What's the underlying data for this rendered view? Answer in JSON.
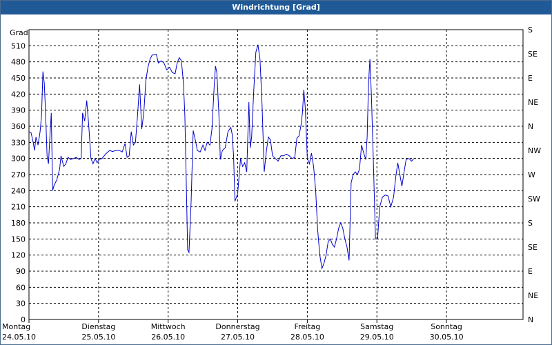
{
  "window": {
    "title": "Windrichtung [Grad]"
  },
  "chart_data": {
    "type": "line",
    "title": "Windrichtung [Grad]",
    "ylabel": "Grad",
    "ylim": [
      0,
      540
    ],
    "y_ticks": [
      0,
      30,
      60,
      90,
      120,
      150,
      180,
      210,
      240,
      270,
      300,
      330,
      360,
      390,
      420,
      450,
      480,
      510
    ],
    "y2_ticks": [
      "N",
      "NE",
      "E",
      "SE",
      "S",
      "SW",
      "W",
      "NW",
      "N",
      "NE",
      "E",
      "SE",
      "S"
    ],
    "x_days": [
      {
        "day": "Montag",
        "date": "24.05.10"
      },
      {
        "day": "Dienstag",
        "date": "25.05.10"
      },
      {
        "day": "Mittwoch",
        "date": "26.05.10"
      },
      {
        "day": "Donnerstag",
        "date": "27.05.10"
      },
      {
        "day": "Freitag",
        "date": "28.05.10"
      },
      {
        "day": "Samstag",
        "date": "29.05.10"
      },
      {
        "day": "Sonntag",
        "date": "30.05.10"
      }
    ],
    "xlim_days": [
      0,
      7.1
    ],
    "grid": true,
    "series": [
      {
        "color": "#0000cc",
        "points": [
          [
            0.0,
            350
          ],
          [
            0.03,
            348
          ],
          [
            0.06,
            330
          ],
          [
            0.08,
            315
          ],
          [
            0.1,
            340
          ],
          [
            0.13,
            325
          ],
          [
            0.16,
            350
          ],
          [
            0.18,
            380
          ],
          [
            0.2,
            462
          ],
          [
            0.22,
            440
          ],
          [
            0.24,
            380
          ],
          [
            0.26,
            305
          ],
          [
            0.28,
            290
          ],
          [
            0.3,
            340
          ],
          [
            0.32,
            385
          ],
          [
            0.34,
            240
          ],
          [
            0.36,
            250
          ],
          [
            0.4,
            260
          ],
          [
            0.44,
            280
          ],
          [
            0.46,
            305
          ],
          [
            0.48,
            295
          ],
          [
            0.5,
            285
          ],
          [
            0.53,
            290
          ],
          [
            0.56,
            302
          ],
          [
            0.6,
            298
          ],
          [
            0.64,
            300
          ],
          [
            0.68,
            302
          ],
          [
            0.72,
            298
          ],
          [
            0.75,
            300
          ],
          [
            0.77,
            385
          ],
          [
            0.8,
            370
          ],
          [
            0.83,
            408
          ],
          [
            0.86,
            360
          ],
          [
            0.89,
            300
          ],
          [
            0.92,
            290
          ],
          [
            0.95,
            300
          ],
          [
            0.98,
            292
          ],
          [
            1.01,
            298
          ],
          [
            1.05,
            300
          ],
          [
            1.1,
            308
          ],
          [
            1.16,
            315
          ],
          [
            1.2,
            313
          ],
          [
            1.25,
            315
          ],
          [
            1.3,
            315
          ],
          [
            1.34,
            312
          ],
          [
            1.38,
            328
          ],
          [
            1.41,
            302
          ],
          [
            1.44,
            305
          ],
          [
            1.47,
            350
          ],
          [
            1.5,
            325
          ],
          [
            1.53,
            330
          ],
          [
            1.56,
            380
          ],
          [
            1.59,
            438
          ],
          [
            1.62,
            355
          ],
          [
            1.65,
            385
          ],
          [
            1.68,
            445
          ],
          [
            1.71,
            470
          ],
          [
            1.74,
            485
          ],
          [
            1.77,
            493
          ],
          [
            1.8,
            493
          ],
          [
            1.83,
            494
          ],
          [
            1.86,
            478
          ],
          [
            1.9,
            482
          ],
          [
            1.94,
            478
          ],
          [
            1.98,
            465
          ],
          [
            2.02,
            470
          ],
          [
            2.06,
            460
          ],
          [
            2.1,
            458
          ],
          [
            2.13,
            478
          ],
          [
            2.16,
            488
          ],
          [
            2.19,
            482
          ],
          [
            2.22,
            440
          ],
          [
            2.24,
            380
          ],
          [
            2.26,
            260
          ],
          [
            2.28,
            130
          ],
          [
            2.3,
            125
          ],
          [
            2.33,
            220
          ],
          [
            2.36,
            352
          ],
          [
            2.39,
            335
          ],
          [
            2.42,
            315
          ],
          [
            2.46,
            312
          ],
          [
            2.5,
            325
          ],
          [
            2.53,
            315
          ],
          [
            2.56,
            330
          ],
          [
            2.6,
            325
          ],
          [
            2.63,
            355
          ],
          [
            2.66,
            430
          ],
          [
            2.68,
            472
          ],
          [
            2.7,
            460
          ],
          [
            2.73,
            380
          ],
          [
            2.75,
            298
          ],
          [
            2.78,
            315
          ],
          [
            2.82,
            320
          ],
          [
            2.86,
            350
          ],
          [
            2.9,
            358
          ],
          [
            2.92,
            345
          ],
          [
            2.94,
            305
          ],
          [
            2.96,
            220
          ],
          [
            3.0,
            235
          ],
          [
            3.04,
            300
          ],
          [
            3.07,
            285
          ],
          [
            3.1,
            292
          ],
          [
            3.13,
            275
          ],
          [
            3.16,
            405
          ],
          [
            3.18,
            320
          ],
          [
            3.2,
            340
          ],
          [
            3.23,
            425
          ],
          [
            3.26,
            498
          ],
          [
            3.29,
            512
          ],
          [
            3.32,
            485
          ],
          [
            3.35,
            400
          ],
          [
            3.38,
            275
          ],
          [
            3.41,
            312
          ],
          [
            3.44,
            340
          ],
          [
            3.47,
            335
          ],
          [
            3.5,
            305
          ],
          [
            3.54,
            300
          ],
          [
            3.58,
            295
          ],
          [
            3.62,
            305
          ],
          [
            3.66,
            305
          ],
          [
            3.7,
            308
          ],
          [
            3.74,
            305
          ],
          [
            3.78,
            300
          ],
          [
            3.82,
            302
          ],
          [
            3.85,
            338
          ],
          [
            3.88,
            342
          ],
          [
            3.91,
            362
          ],
          [
            3.93,
            385
          ],
          [
            3.95,
            428
          ],
          [
            3.97,
            395
          ],
          [
            4.0,
            300
          ],
          [
            4.03,
            290
          ],
          [
            4.06,
            310
          ],
          [
            4.09,
            285
          ],
          [
            4.12,
            240
          ],
          [
            4.15,
            165
          ],
          [
            4.18,
            120
          ],
          [
            4.21,
            95
          ],
          [
            4.24,
            105
          ],
          [
            4.27,
            120
          ],
          [
            4.3,
            145
          ],
          [
            4.33,
            150
          ],
          [
            4.36,
            140
          ],
          [
            4.39,
            135
          ],
          [
            4.42,
            150
          ],
          [
            4.45,
            170
          ],
          [
            4.48,
            180
          ],
          [
            4.51,
            170
          ],
          [
            4.54,
            150
          ],
          [
            4.57,
            135
          ],
          [
            4.6,
            110
          ],
          [
            4.63,
            255
          ],
          [
            4.66,
            270
          ],
          [
            4.69,
            275
          ],
          [
            4.72,
            270
          ],
          [
            4.75,
            280
          ],
          [
            4.78,
            325
          ],
          [
            4.81,
            310
          ],
          [
            4.84,
            298
          ],
          [
            4.86,
            340
          ],
          [
            4.88,
            440
          ],
          [
            4.9,
            485
          ],
          [
            4.92,
            420
          ],
          [
            4.95,
            290
          ],
          [
            4.98,
            150
          ],
          [
            5.01,
            150
          ],
          [
            5.04,
            210
          ],
          [
            5.08,
            228
          ],
          [
            5.12,
            232
          ],
          [
            5.16,
            230
          ],
          [
            5.2,
            210
          ],
          [
            5.24,
            228
          ],
          [
            5.27,
            265
          ],
          [
            5.3,
            292
          ],
          [
            5.33,
            270
          ],
          [
            5.36,
            248
          ],
          [
            5.39,
            275
          ],
          [
            5.42,
            298
          ],
          [
            5.46,
            300
          ],
          [
            5.5,
            295
          ],
          [
            5.53,
            300
          ]
        ]
      }
    ]
  }
}
